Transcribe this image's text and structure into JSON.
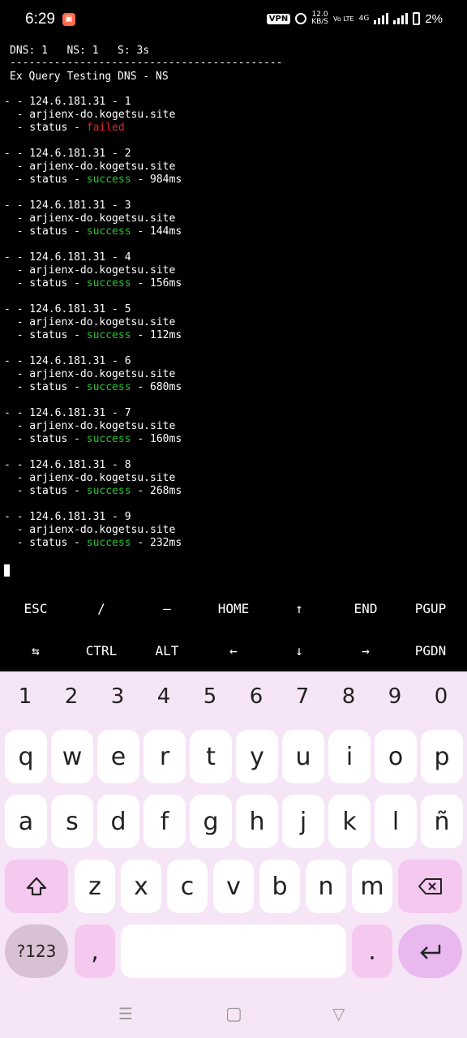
{
  "status_bar": {
    "time": "6:29",
    "vpn_label": "VPN",
    "speed_value": "12.0",
    "speed_unit": "KB/S",
    "volte_label": "Vo LTE",
    "network_label": "4G",
    "battery_percent": "2%"
  },
  "terminal": {
    "header_counts": "DNS: 1   NS: 1   S: 3s",
    "separator": "-------------------------------------------",
    "title": "Ex Query Testing DNS - NS",
    "queries": [
      {
        "header": "- - 124.6.181.31 - 1",
        "domain": "  - arjienx-do.kogetsu.site",
        "status_prefix": "  - status - ",
        "result": "failed",
        "result_state": "failed",
        "time": ""
      },
      {
        "header": "- - 124.6.181.31 - 2",
        "domain": "  - arjienx-do.kogetsu.site",
        "status_prefix": "  - status - ",
        "result": "success",
        "result_state": "success",
        "time": " - 984ms"
      },
      {
        "header": "- - 124.6.181.31 - 3",
        "domain": "  - arjienx-do.kogetsu.site",
        "status_prefix": "  - status - ",
        "result": "success",
        "result_state": "success",
        "time": " - 144ms"
      },
      {
        "header": "- - 124.6.181.31 - 4",
        "domain": "  - arjienx-do.kogetsu.site",
        "status_prefix": "  - status - ",
        "result": "success",
        "result_state": "success",
        "time": " - 156ms"
      },
      {
        "header": "- - 124.6.181.31 - 5",
        "domain": "  - arjienx-do.kogetsu.site",
        "status_prefix": "  - status - ",
        "result": "success",
        "result_state": "success",
        "time": " - 112ms"
      },
      {
        "header": "- - 124.6.181.31 - 6",
        "domain": "  - arjienx-do.kogetsu.site",
        "status_prefix": "  - status - ",
        "result": "success",
        "result_state": "success",
        "time": " - 680ms"
      },
      {
        "header": "- - 124.6.181.31 - 7",
        "domain": "  - arjienx-do.kogetsu.site",
        "status_prefix": "  - status - ",
        "result": "success",
        "result_state": "success",
        "time": " - 160ms"
      },
      {
        "header": "- - 124.6.181.31 - 8",
        "domain": "  - arjienx-do.kogetsu.site",
        "status_prefix": "  - status - ",
        "result": "success",
        "result_state": "success",
        "time": " - 268ms"
      },
      {
        "header": "- - 124.6.181.31 - 9",
        "domain": "  - arjienx-do.kogetsu.site",
        "status_prefix": "  - status - ",
        "result": "success",
        "result_state": "success",
        "time": " - 232ms"
      }
    ]
  },
  "extra_keys": {
    "row1": [
      "ESC",
      "/",
      "—",
      "HOME",
      "↑",
      "END",
      "PGUP"
    ],
    "row2": [
      "⇆",
      "CTRL",
      "ALT",
      "←",
      "↓",
      "→",
      "PGDN"
    ]
  },
  "keyboard": {
    "numbers": [
      "1",
      "2",
      "3",
      "4",
      "5",
      "6",
      "7",
      "8",
      "9",
      "0"
    ],
    "row1": [
      "q",
      "w",
      "e",
      "r",
      "t",
      "y",
      "u",
      "i",
      "o",
      "p"
    ],
    "row2": [
      "a",
      "s",
      "d",
      "f",
      "g",
      "h",
      "j",
      "k",
      "l",
      "ñ"
    ],
    "row3": [
      "z",
      "x",
      "c",
      "v",
      "b",
      "n",
      "m"
    ],
    "symbols_label": "?123",
    "comma_label": ",",
    "period_label": ".",
    "shift_icon": "shift-arrow-icon",
    "backspace_icon": "backspace-icon",
    "enter_icon": "enter-arrow-icon"
  },
  "colors": {
    "success": "#29c234",
    "failed": "#e3242b",
    "keyboard_bg": "#f6e5f6",
    "enter_key": "#e8b8ef"
  }
}
